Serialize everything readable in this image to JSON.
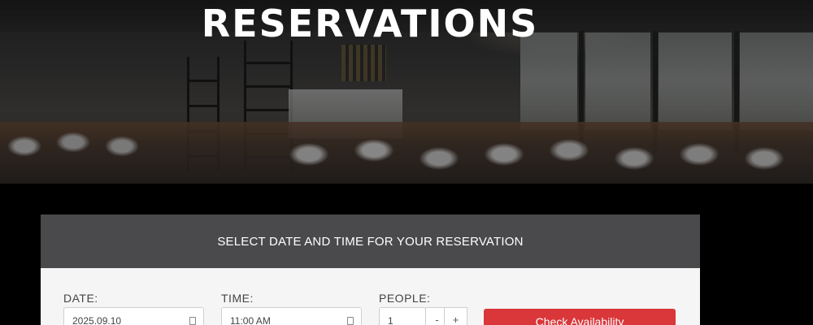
{
  "hero": {
    "title": "RESERVATIONS"
  },
  "reservation": {
    "header": "SELECT DATE AND TIME FOR YOUR RESERVATION",
    "date": {
      "label": "DATE:",
      "value": "2025.09.10",
      "icon": "calendar-icon"
    },
    "time": {
      "label": "TIME:",
      "value": "11:00 AM",
      "icon": "clock-icon"
    },
    "people": {
      "label": "PEOPLE:",
      "value": "1",
      "decrement": "-",
      "increment": "+"
    },
    "submit_label": "Check Availability",
    "colors": {
      "header_bg": "#4a4a4c",
      "body_bg": "#f5f5f5",
      "button_bg": "#d9373a"
    }
  }
}
